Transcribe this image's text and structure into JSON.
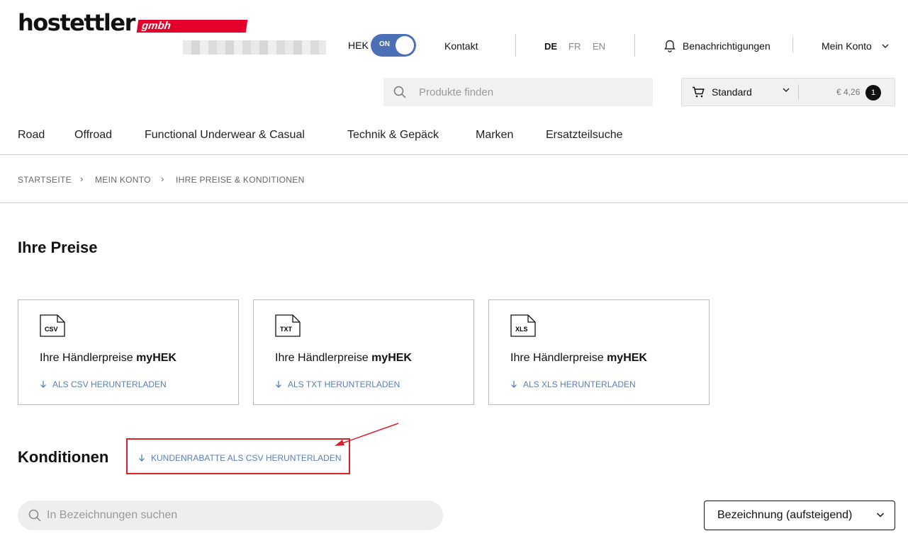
{
  "header": {
    "logo_text": "hostettler",
    "logo_badge": "gmbh",
    "hek_label": "HEK",
    "toggle_label": "ON",
    "contact": "Kontakt",
    "languages": [
      "DE",
      "FR",
      "EN"
    ],
    "active_language": "DE",
    "notifications": "Benachrichtigungen",
    "account": "Mein Konto",
    "search_placeholder": "Produkte finden",
    "cart": {
      "label": "Standard",
      "price": "€ 4,26",
      "count": "1"
    }
  },
  "nav": [
    "Road",
    "Offroad",
    "Functional Underwear & Casual",
    "Technik & Gepäck",
    "Marken",
    "Ersatzteilsuche"
  ],
  "breadcrumb": [
    "STARTSEITE",
    "MEIN KONTO",
    "IHRE PREISE & KONDITIONEN"
  ],
  "prices": {
    "heading": "Ihre Preise",
    "cards": [
      {
        "icon": "CSV",
        "title_prefix": "Ihre Händlerpreise ",
        "title_bold": "myHEK",
        "link": "ALS CSV HERUNTERLADEN"
      },
      {
        "icon": "TXT",
        "title_prefix": "Ihre Händlerpreise ",
        "title_bold": "myHEK",
        "link": "ALS TXT HERUNTERLADEN"
      },
      {
        "icon": "XLS",
        "title_prefix": "Ihre Händlerpreise ",
        "title_bold": "myHEK",
        "link": "ALS XLS HERUNTERLADEN"
      }
    ]
  },
  "conditions": {
    "heading": "Konditionen",
    "download_link": "KUNDENRABATTE ALS CSV HERUNTERLADEN",
    "search_placeholder": "In Bezeichnungen suchen",
    "sort_value": "Bezeichnung (aufsteigend)"
  },
  "colors": {
    "accent": "#4b70b5",
    "link": "#5b7db3",
    "brand_red": "#e3002b",
    "annotation_red": "#d9212b"
  }
}
